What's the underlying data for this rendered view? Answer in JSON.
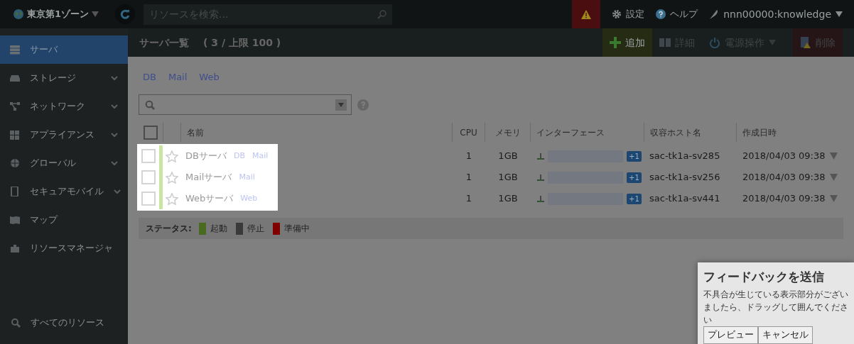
{
  "zone": {
    "label": "東京第1ゾーン"
  },
  "search": {
    "placeholder": "リソースを検索..."
  },
  "alert": {
    "on": true
  },
  "header_links": [
    {
      "kind": "settings",
      "label": "設定"
    },
    {
      "kind": "help",
      "label": "ヘルプ"
    },
    {
      "kind": "user",
      "label": "nnn00000:knowledge"
    }
  ],
  "sidebar": {
    "items": [
      {
        "kind": "server",
        "label": "サーバ",
        "selected": true,
        "expandable": false
      },
      {
        "kind": "storage",
        "label": "ストレージ",
        "selected": false,
        "expandable": true
      },
      {
        "kind": "network",
        "label": "ネットワーク",
        "selected": false,
        "expandable": true
      },
      {
        "kind": "appliance",
        "label": "アプライアンス",
        "selected": false,
        "expandable": true
      },
      {
        "kind": "global",
        "label": "グローバル",
        "selected": false,
        "expandable": true
      },
      {
        "kind": "mobile",
        "label": "セキュアモバイル",
        "selected": false,
        "expandable": true
      },
      {
        "kind": "map",
        "label": "マップ",
        "selected": false,
        "expandable": false
      },
      {
        "kind": "manager",
        "label": "リソースマネージャ",
        "selected": false,
        "expandable": false
      }
    ],
    "bottom_item": {
      "label": "すべてのリソース"
    }
  },
  "page": {
    "title": "サーバ一覧",
    "count": "( 3 / 上限 100 )"
  },
  "toolbar": [
    {
      "kind": "add",
      "label": "追加",
      "disabled": false
    },
    {
      "kind": "detail",
      "label": "詳細",
      "disabled": true
    },
    {
      "kind": "power",
      "label": "電源操作",
      "disabled": true
    },
    {
      "kind": "delete",
      "label": "削除",
      "disabled": true
    }
  ],
  "tag_filters": [
    "DB",
    "Mail",
    "Web"
  ],
  "table": {
    "columns": [
      "名前",
      "CPU",
      "メモリ",
      "インターフェース",
      "収容ホスト名",
      "作成日時"
    ],
    "select_all": {
      "checked": false
    },
    "rows": [
      {
        "name": "DBサーバ",
        "tags": [
          "DB",
          "Mail"
        ],
        "cpu": "1",
        "memory": "1GB",
        "interface_extra": "+1",
        "host": "sac-tk1a-sv285",
        "created": "2018/04/03 09:38",
        "color": "#c8e6a0",
        "checked": false,
        "starred": false
      },
      {
        "name": "Mailサーバ",
        "tags": [
          "Mail"
        ],
        "cpu": "1",
        "memory": "1GB",
        "interface_extra": "+1",
        "host": "sac-tk1a-sv256",
        "created": "2018/04/03 09:38",
        "color": "#c8e6a0",
        "checked": false,
        "starred": false
      },
      {
        "name": "Webサーバ",
        "tags": [
          "Web"
        ],
        "cpu": "1",
        "memory": "1GB",
        "interface_extra": "+1",
        "host": "sac-tk1a-sv441",
        "created": "2018/04/03 09:38",
        "color": "#c8e6a0",
        "checked": false,
        "starred": false
      }
    ]
  },
  "legend": {
    "label": "ステータス:",
    "items": [
      {
        "label": "起動",
        "color": "#4a6a22"
      },
      {
        "label": "停止",
        "color": "#3a3a3a"
      },
      {
        "label": "準備中",
        "color": "#800000"
      }
    ]
  },
  "feedback": {
    "title": "フィードバックを送信",
    "message": "不具合が生じている表示部分がございましたら、ドラッグして囲んでください",
    "buttons": [
      "プレビュー",
      "キャンセル"
    ]
  }
}
